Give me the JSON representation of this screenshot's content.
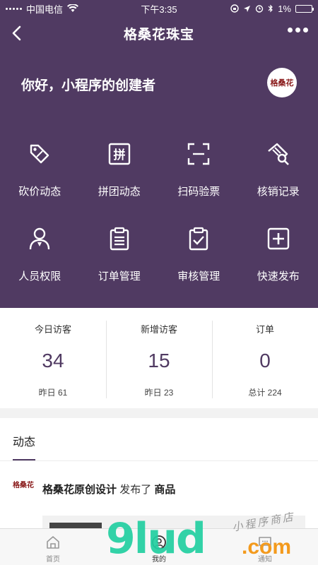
{
  "status_bar": {
    "carrier": "中国电信",
    "time": "下午3:35",
    "battery": "1%"
  },
  "nav": {
    "title": "格桑花珠宝"
  },
  "header": {
    "greeting": "你好，小程序的创建者",
    "logo_text": "格桑花"
  },
  "menu": [
    {
      "label": "砍价动态",
      "icon": "tag-icon"
    },
    {
      "label": "拼团动态",
      "icon": "group-pin-icon"
    },
    {
      "label": "扫码验票",
      "icon": "scan-icon"
    },
    {
      "label": "核销记录",
      "icon": "ticket-search-icon"
    },
    {
      "label": "人员权限",
      "icon": "user-icon"
    },
    {
      "label": "订单管理",
      "icon": "clipboard-list-icon"
    },
    {
      "label": "审核管理",
      "icon": "clipboard-check-icon"
    },
    {
      "label": "快速发布",
      "icon": "plus-square-icon"
    }
  ],
  "stats": [
    {
      "title": "今日访客",
      "value": "34",
      "sub": "昨日 61"
    },
    {
      "title": "新增访客",
      "value": "15",
      "sub": "昨日 23"
    },
    {
      "title": "订单",
      "value": "0",
      "sub": "总计 224"
    }
  ],
  "feed": {
    "tab": "动态",
    "item": {
      "logo_text": "格桑花",
      "author": "格桑花原创设计",
      "action": "发布了",
      "object": "商品"
    }
  },
  "tabbar": [
    {
      "label": "首页",
      "icon": "home-icon"
    },
    {
      "label": "我的",
      "icon": "user-circle-icon"
    },
    {
      "label": "通知",
      "icon": "message-icon"
    }
  ],
  "watermark": {
    "main": "9lud",
    "suffix": ".com",
    "tagline": "小程序商店"
  },
  "colors": {
    "primary": "#503a62",
    "watermark_green": "#22cfa1",
    "watermark_orange": "#f39a1d"
  }
}
